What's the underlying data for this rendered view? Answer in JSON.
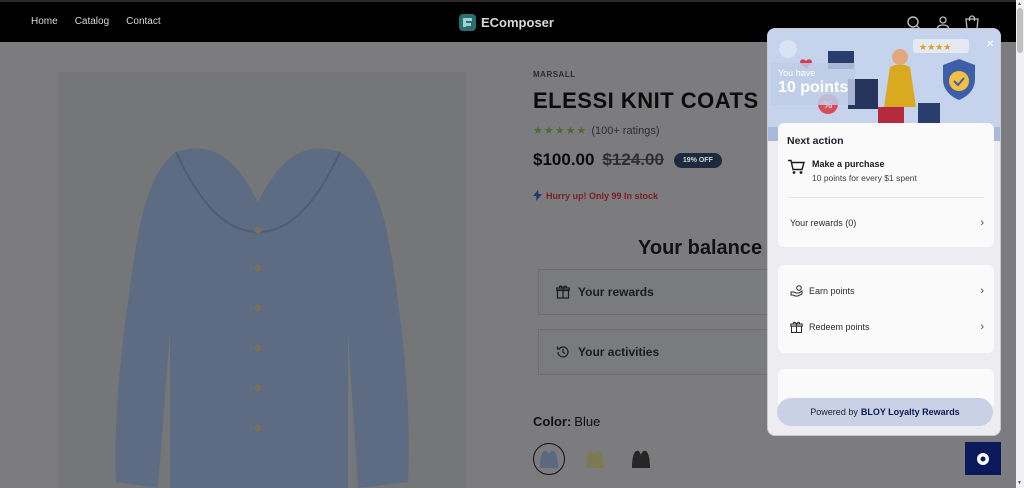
{
  "header": {
    "nav": [
      "Home",
      "Catalog",
      "Contact"
    ],
    "brand": "EComposer"
  },
  "product": {
    "vendor": "MARSALL",
    "title": "ELESSI KNIT COATS",
    "stars": "★★★★★",
    "rating_text": "(100+ ratings)",
    "price": "$100.00",
    "compare_price": "$124.00",
    "discount_badge": "19% OFF",
    "stock_text": "Hurry up! Only 99 In stock",
    "color_label": "Color:",
    "color_value": "Blue",
    "swatches": [
      "Blue",
      "Yellow",
      "Black"
    ]
  },
  "balance": {
    "title": "Your balance",
    "rewards": "Your rewards",
    "activities": "Your activities"
  },
  "loyalty": {
    "you_have": "You have",
    "points": "10 points",
    "next_action_title": "Next action",
    "purchase_title": "Make a purchase",
    "purchase_desc": "10 points for every $1 spent",
    "your_rewards": "Your rewards (0)",
    "earn_points": "Earn points",
    "redeem_points": "Redeem points",
    "powered_by": "Powered by",
    "powered_brand": "BLOY Loyalty Rewards"
  },
  "colors": {
    "accent_navy": "#0b1a5a",
    "star_green": "#4f6a33",
    "stock_red": "#7a1f25"
  }
}
